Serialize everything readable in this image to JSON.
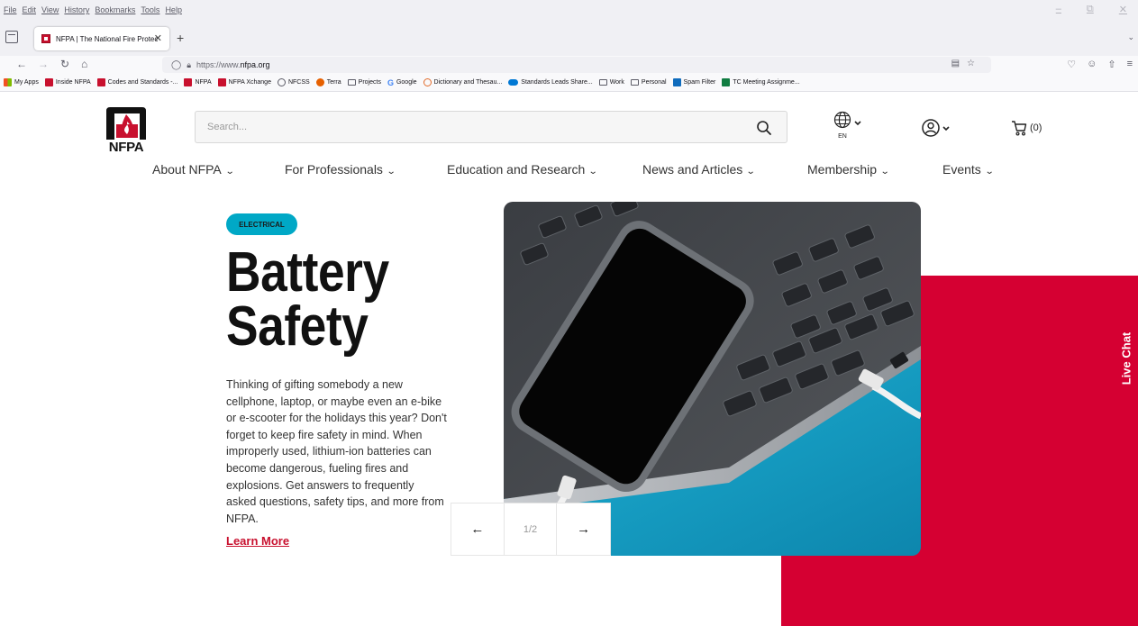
{
  "browser": {
    "menu": [
      "File",
      "Edit",
      "View",
      "History",
      "Bookmarks",
      "Tools",
      "Help"
    ],
    "tab_title": "NFPA | The National Fire Protec",
    "url_prefix": "https://www.",
    "url_domain": "nfpa.org",
    "bookmarks": [
      {
        "label": "My Apps",
        "icon": "apps-icon"
      },
      {
        "label": "Inside NFPA",
        "icon": "nfpa-favicon"
      },
      {
        "label": "Codes and Standards -...",
        "icon": "nfpa-favicon"
      },
      {
        "label": "NFPA",
        "icon": "nfpa-favicon"
      },
      {
        "label": "NFPA Xchange",
        "icon": "nfpa-favicon"
      },
      {
        "label": "NFCSS",
        "icon": "globe-icon"
      },
      {
        "label": "Terra",
        "icon": "firefox-icon"
      },
      {
        "label": "Projects",
        "icon": "folder-icon"
      },
      {
        "label": "Google",
        "icon": "google-icon"
      },
      {
        "label": "Dictionary and Thesau...",
        "icon": "dictionary-icon"
      },
      {
        "label": "Standards Leads Share...",
        "icon": "onedrive-icon"
      },
      {
        "label": "Work",
        "icon": "folder-icon"
      },
      {
        "label": "Personal",
        "icon": "folder-icon"
      },
      {
        "label": "Spam Filter",
        "icon": "spam-filter-icon"
      },
      {
        "label": "TC Meeting Assignme...",
        "icon": "excel-icon"
      }
    ]
  },
  "header": {
    "logo_text": "NFPA",
    "search_placeholder": "Search...",
    "lang_code": "EN",
    "cart_count": "(0)"
  },
  "nav": {
    "items": [
      "About NFPA",
      "For Professionals",
      "Education and Research",
      "News and Articles",
      "Membership",
      "Events"
    ]
  },
  "hero": {
    "badge": "ELECTRICAL",
    "title_line1": "Battery",
    "title_line2": "Safety",
    "description": "Thinking of gifting somebody a new cellphone, laptop, or maybe even an e-bike or e-scooter for the holidays this year? Don't forget to keep fire safety in mind. When improperly used, lithium-ion batteries can become dangerous, fueling fires and explosions. Get answers to frequently asked questions, safety tips, and more from NFPA.",
    "cta": "Learn More",
    "slide_counter": "1/2"
  },
  "live_chat": "Live Chat",
  "colors": {
    "brand_red": "#d50032",
    "badge_teal": "#00a8c6",
    "link_red": "#c8102e"
  }
}
